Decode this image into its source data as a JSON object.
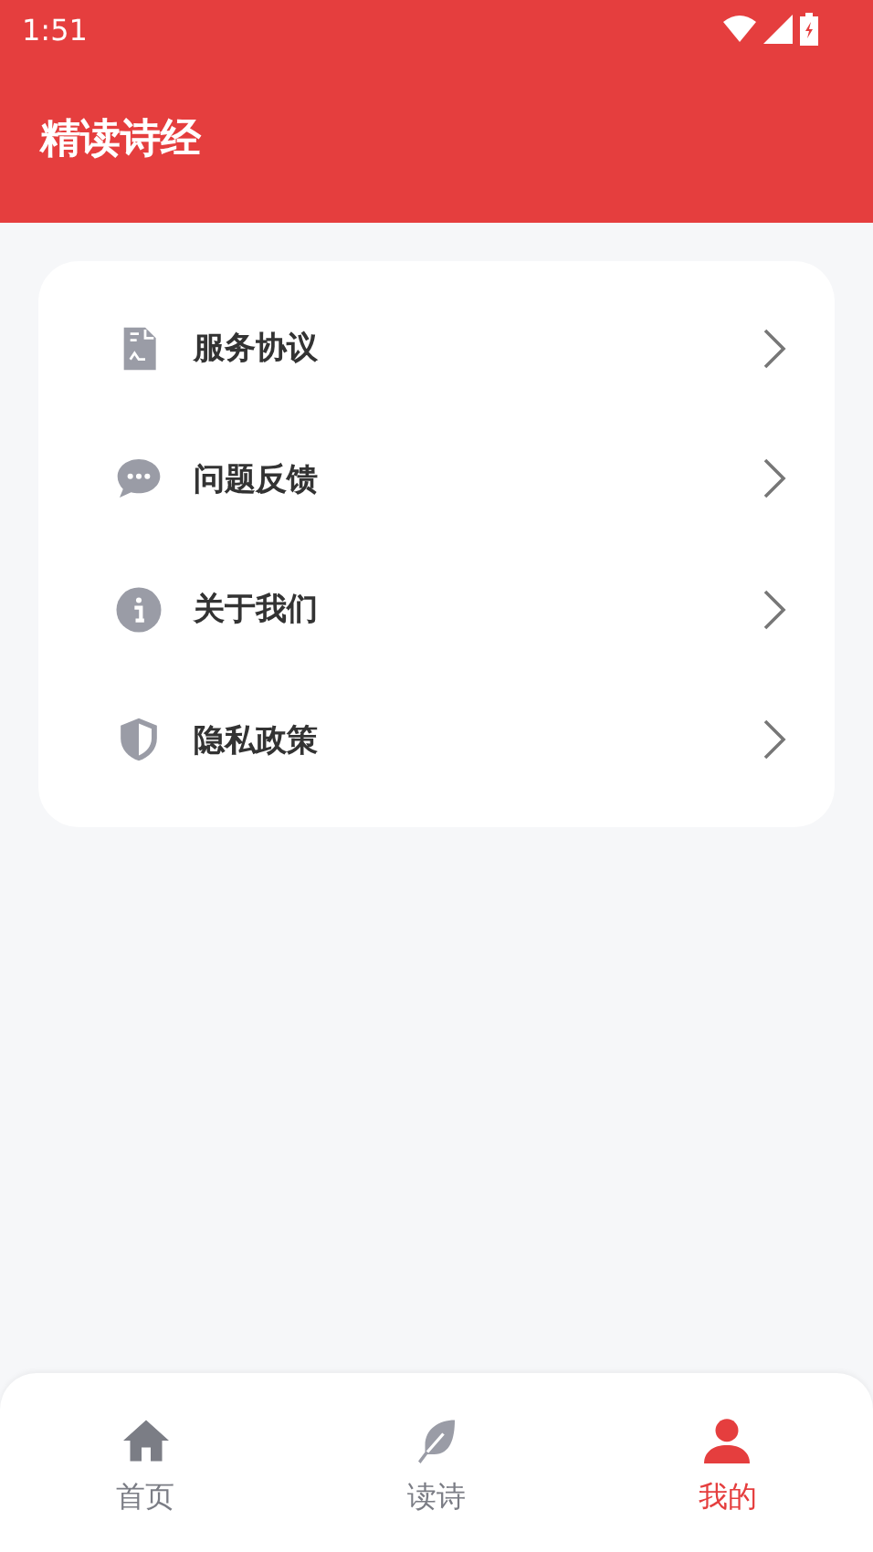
{
  "status_bar": {
    "time": "1:51"
  },
  "header": {
    "title": "精读诗经"
  },
  "menu": [
    {
      "label": "服务协议"
    },
    {
      "label": "问题反馈"
    },
    {
      "label": "关于我们"
    },
    {
      "label": "隐私政策"
    }
  ],
  "bottom_nav": [
    {
      "label": "首页",
      "selected": false
    },
    {
      "label": "读诗",
      "selected": false
    },
    {
      "label": "我的",
      "selected": true
    }
  ]
}
